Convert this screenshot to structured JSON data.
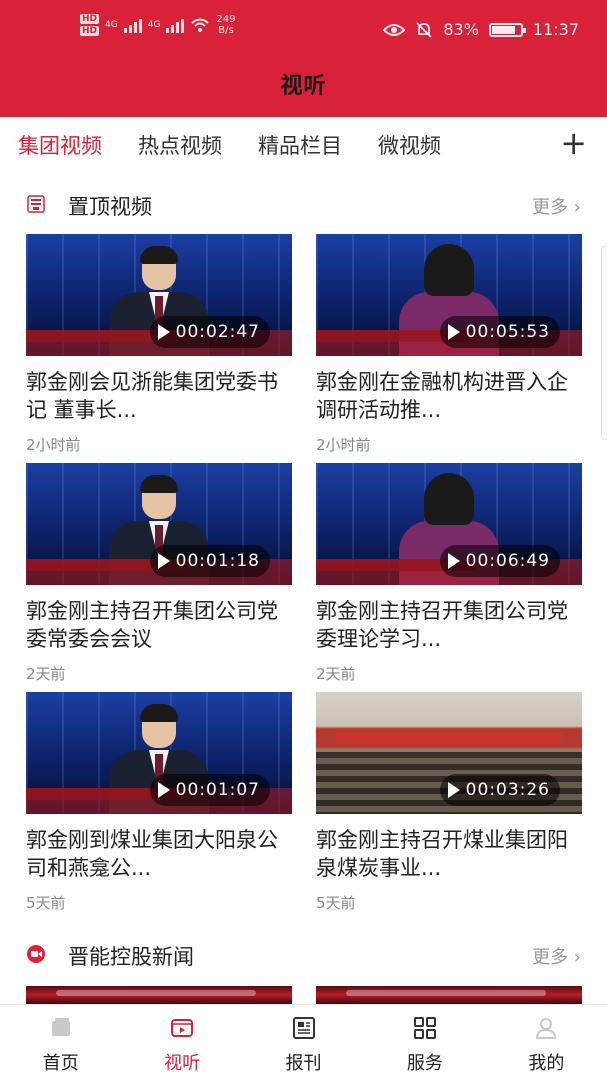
{
  "status_bar": {
    "hd1": "HD",
    "hd2": "HD",
    "net1": "4G",
    "net2": "4G",
    "speed_value": "249",
    "speed_unit": "B/s",
    "battery": "83%",
    "battery_level": 0.83,
    "time": "11:37"
  },
  "header": {
    "title": "视听"
  },
  "tabs": [
    {
      "label": "集团视频",
      "active": true
    },
    {
      "label": "热点视频",
      "active": false
    },
    {
      "label": "精品栏目",
      "active": false
    },
    {
      "label": "微视频",
      "active": false
    }
  ],
  "tab_add": "+",
  "sections": [
    {
      "title": "置顶视频",
      "more": "更多 ›",
      "icon": "pinned-badge-icon"
    },
    {
      "title": "晋能控股新闻",
      "more": "更多 ›",
      "icon": "video-camera-icon"
    }
  ],
  "videos": [
    {
      "title": "郭金刚会见浙能集团党委书记  董事长...",
      "duration": "00:02:47",
      "time": "2小时前",
      "thumb": "anchor-male"
    },
    {
      "title": "郭金刚在金融机构进晋入企调研活动推...",
      "duration": "00:05:53",
      "time": "2小时前",
      "thumb": "anchor-female"
    },
    {
      "title": "郭金刚主持召开集团公司党委常委会会议",
      "duration": "00:01:18",
      "time": "2天前",
      "thumb": "anchor-male"
    },
    {
      "title": "郭金刚主持召开集团公司党委理论学习...",
      "duration": "00:06:49",
      "time": "2天前",
      "thumb": "anchor-female"
    },
    {
      "title": "郭金刚到煤业集团大阳泉公司和燕龛公...",
      "duration": "00:01:07",
      "time": "5天前",
      "thumb": "anchor-male"
    },
    {
      "title": "郭金刚主持召开煤业集团阳泉煤炭事业...",
      "duration": "00:03:26",
      "time": "5天前",
      "thumb": "meeting"
    }
  ],
  "bottom_nav": [
    {
      "label": "首页",
      "icon": "home-icon",
      "active": false
    },
    {
      "label": "视听",
      "icon": "video-icon",
      "active": true
    },
    {
      "label": "报刊",
      "icon": "newspaper-icon",
      "active": false
    },
    {
      "label": "服务",
      "icon": "grid-icon",
      "active": false
    },
    {
      "label": "我的",
      "icon": "profile-icon",
      "active": false
    }
  ],
  "colors": {
    "brand": "#d9213a",
    "text": "#222222",
    "muted": "#888888"
  }
}
